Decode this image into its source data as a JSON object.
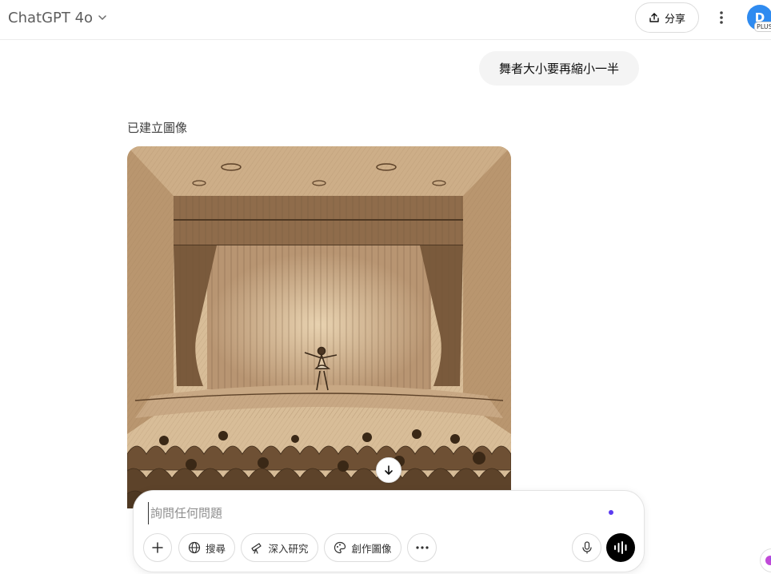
{
  "header": {
    "model_name": "ChatGPT 4o",
    "share_label": "分享",
    "avatar_initial": "D",
    "plan_badge": "PLUS"
  },
  "conversation": {
    "user_message": "舞者大小要再縮小一半",
    "assistant_label": "已建立圖像",
    "image_subject": "sepia pencil sketch of a theater stage with a small dancer and audience"
  },
  "composer": {
    "placeholder": "詢問任何問題",
    "tools": {
      "search_label": "搜尋",
      "research_label": "深入研究",
      "create_image_label": "創作圖像"
    }
  },
  "icons": {
    "model_chevron": "chevron-down-icon",
    "share": "upload-icon",
    "kebab": "more-vertical-icon",
    "scroll_down": "arrow-down-icon",
    "plus": "plus-icon",
    "search": "globe-icon",
    "research": "telescope-icon",
    "image": "palette-icon",
    "more": "more-horizontal-icon",
    "mic": "microphone-icon",
    "voice": "voice-waveform-icon"
  },
  "colors": {
    "avatar": "#2f8bf0",
    "user_bubble": "#f4f4f4",
    "voice_button": "#000000",
    "indicator_dot": "#5b3bf0"
  }
}
